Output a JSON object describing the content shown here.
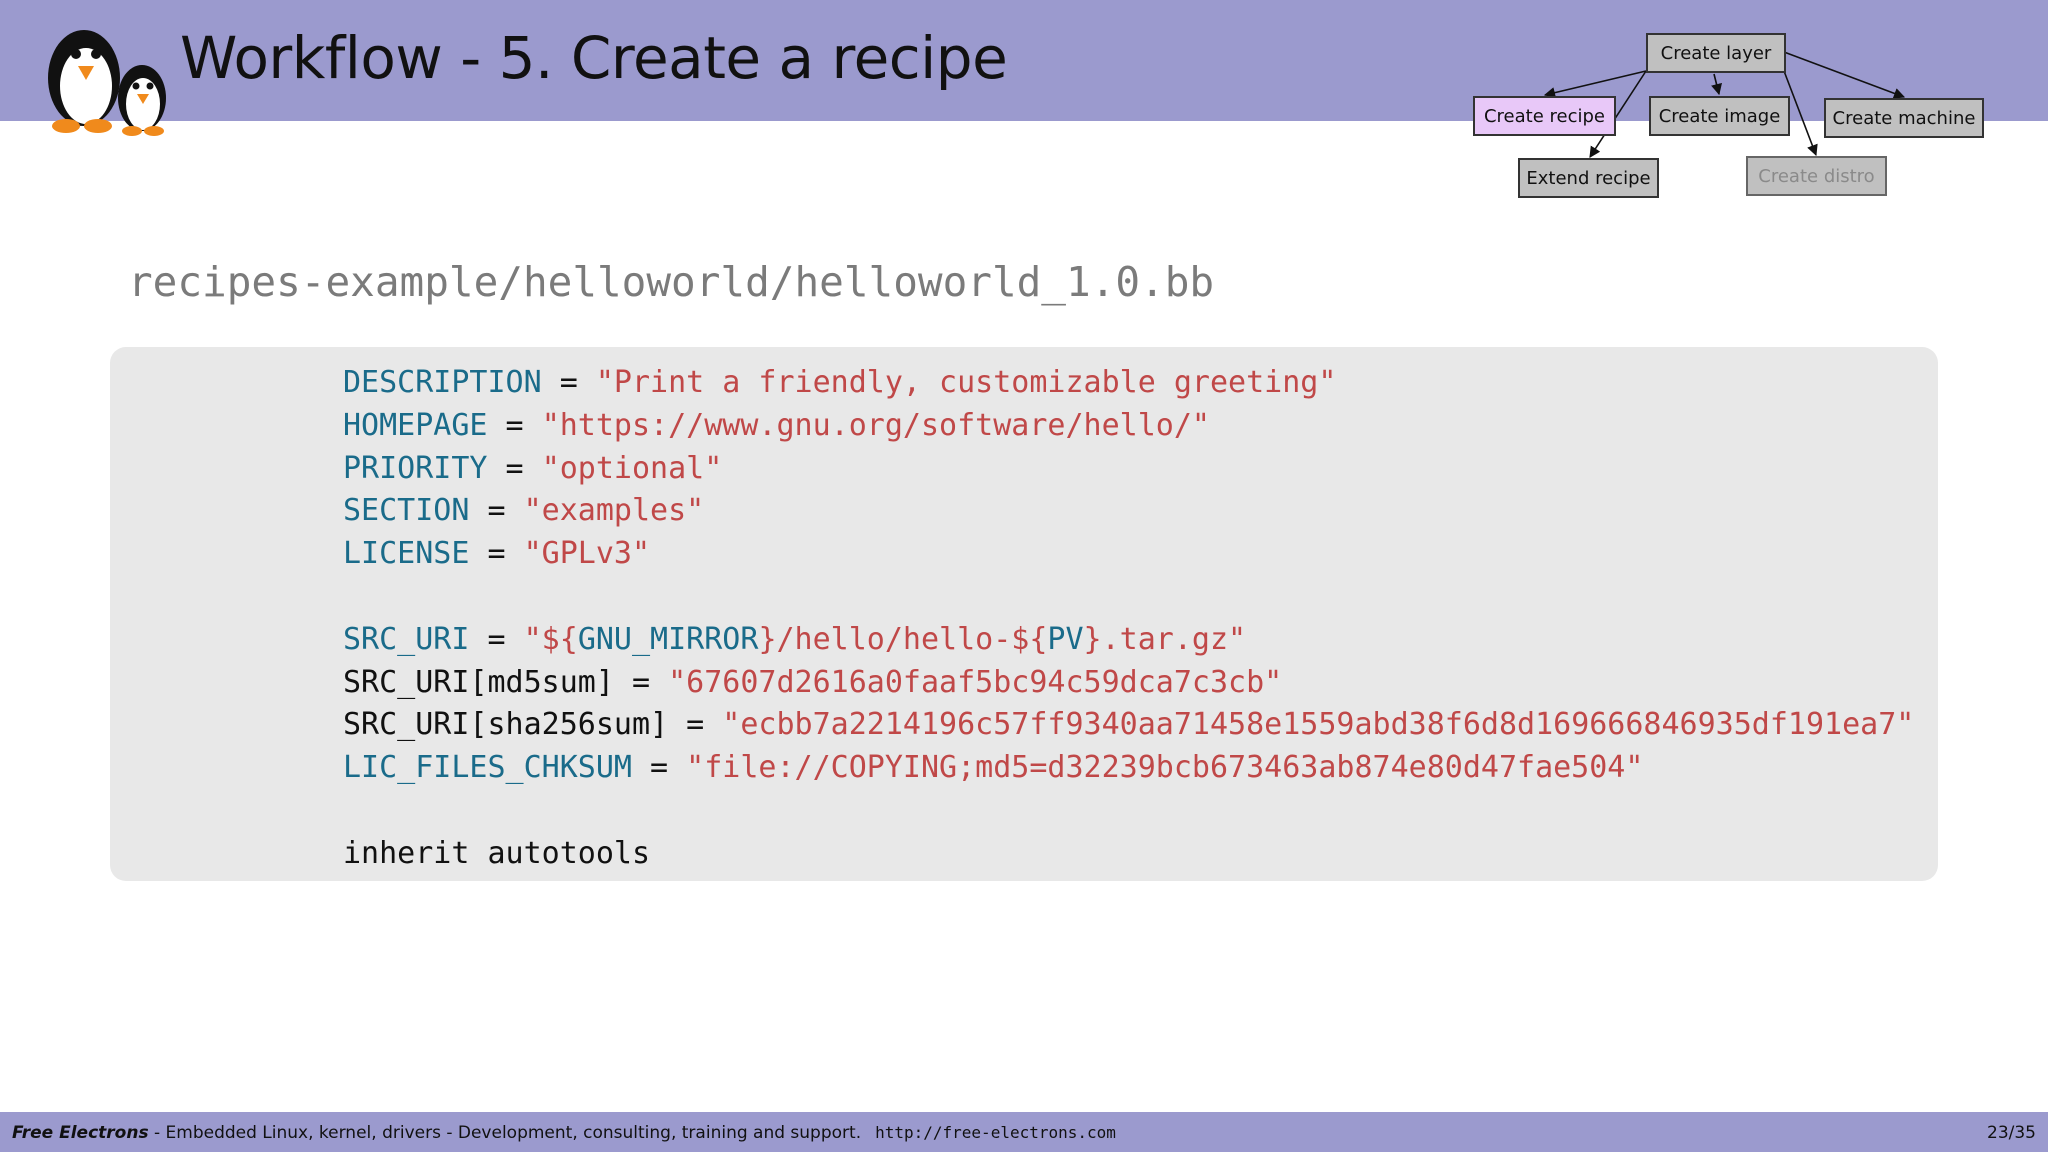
{
  "slide": {
    "title": "Workflow - 5. Create a recipe",
    "file_path": "recipes-example/helloworld/helloworld_1.0.bb"
  },
  "workflow": {
    "create_layer": "Create layer",
    "create_recipe": "Create recipe",
    "create_image": "Create image",
    "create_machine": "Create machine",
    "extend_recipe": "Extend recipe",
    "create_distro": "Create distro",
    "active_node": "Create recipe"
  },
  "code": {
    "lines": [
      [
        {
          "t": "DESCRIPTION",
          "c": "kw"
        },
        {
          "t": " = "
        },
        {
          "t": "\"Print a friendly, customizable greeting\"",
          "c": "str"
        }
      ],
      [
        {
          "t": "HOMEPAGE",
          "c": "kw"
        },
        {
          "t": " = "
        },
        {
          "t": "\"https://www.gnu.org/software/hello/\"",
          "c": "str"
        }
      ],
      [
        {
          "t": "PRIORITY",
          "c": "kw"
        },
        {
          "t": " = "
        },
        {
          "t": "\"optional\"",
          "c": "str"
        }
      ],
      [
        {
          "t": "SECTION",
          "c": "kw"
        },
        {
          "t": " = "
        },
        {
          "t": "\"examples\"",
          "c": "str"
        }
      ],
      [
        {
          "t": "LICENSE",
          "c": "kw"
        },
        {
          "t": " = "
        },
        {
          "t": "\"GPLv3\"",
          "c": "str"
        }
      ],
      [],
      [
        {
          "t": "SRC_URI",
          "c": "kw"
        },
        {
          "t": " = "
        },
        {
          "t": "\"${",
          "c": "str"
        },
        {
          "t": "GNU_MIRROR",
          "c": "kw"
        },
        {
          "t": "}/hello/hello-${",
          "c": "str"
        },
        {
          "t": "PV",
          "c": "kw"
        },
        {
          "t": "}.tar.gz\"",
          "c": "str"
        }
      ],
      [
        {
          "t": "SRC_URI[md5sum] = "
        },
        {
          "t": "\"67607d2616a0faaf5bc94c59dca7c3cb\"",
          "c": "str"
        }
      ],
      [
        {
          "t": "SRC_URI[sha256sum] = "
        },
        {
          "t": "\"ecbb7a2214196c57ff9340aa71458e1559abd38f6d8d169666846935df191ea7\"",
          "c": "str"
        }
      ],
      [
        {
          "t": "LIC_FILES_CHKSUM",
          "c": "kw"
        },
        {
          "t": " = "
        },
        {
          "t": "\"file://COPYING;md5=d32239bcb673463ab874e80d47fae504\"",
          "c": "str"
        }
      ],
      [],
      [
        {
          "t": "inherit autotools"
        }
      ]
    ]
  },
  "footer": {
    "brand": "Free Electrons",
    "tagline": " - Embedded Linux, kernel, drivers - Development, consulting, training and support.",
    "url": "http://free-electrons.com",
    "page": "23/35"
  },
  "colors": {
    "header_bar": "#9b9ace",
    "keyword": "#1a6b8a",
    "string": "#c04848",
    "code_background": "#e8e8e8",
    "active_node": "#e8c8f8"
  },
  "icons": [
    "penguin-logo-icon"
  ]
}
